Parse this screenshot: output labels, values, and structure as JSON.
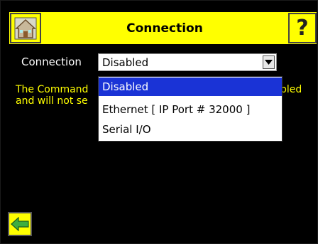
{
  "header": {
    "title": "Connection",
    "help_glyph": "?",
    "home_icon": "home-icon"
  },
  "connection": {
    "label": "Connection",
    "selected_value": "Disabled"
  },
  "info": {
    "line1_visible": "The Command",
    "line1_tail": "bled",
    "line2_visible": "and will not se"
  },
  "dropdown": {
    "options": [
      {
        "label": "Disabled",
        "selected": true
      },
      {
        "label": "Ethernet [ IP Port # 32000 ]",
        "selected": false
      },
      {
        "label": "Serial I/O",
        "selected": false
      }
    ]
  },
  "footer": {
    "back_icon": "back-arrow-icon"
  },
  "colors": {
    "accent": "#ffff00",
    "selection": "#1a33d6",
    "background": "#000000"
  }
}
